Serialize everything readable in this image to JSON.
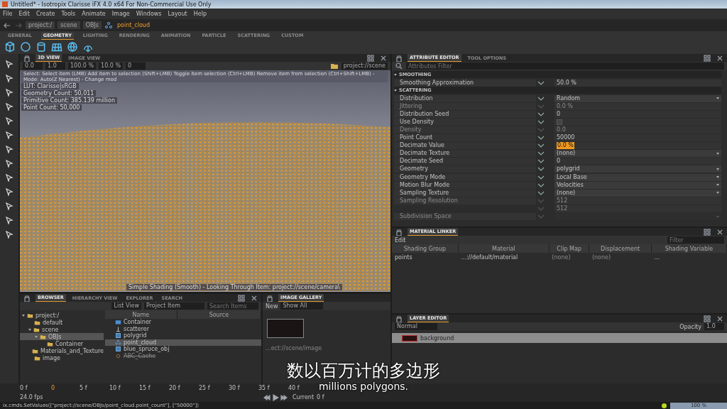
{
  "window": {
    "title": "Untitled* - Isotropix Clarisse iFX 4.0 x64  For Non-Commercial Use Only"
  },
  "menu": [
    "File",
    "Edit",
    "Create",
    "Tools",
    "Animate",
    "Image",
    "Windows",
    "Layout",
    "Help"
  ],
  "path_bar": {
    "segments": [
      "project:/",
      "scene",
      "OBJs"
    ],
    "current": "point_cloud"
  },
  "shelf": {
    "tabs": [
      {
        "label": "GENERAL",
        "selected": false
      },
      {
        "label": "GEOMETRY",
        "selected": true
      },
      {
        "label": "LIGHTING",
        "selected": false
      },
      {
        "label": "RENDERING",
        "selected": false
      },
      {
        "label": "ANIMATION",
        "selected": false
      },
      {
        "label": "PARTICLE",
        "selected": false
      },
      {
        "label": "SCATTERING",
        "selected": false
      },
      {
        "label": "CUSTOM",
        "selected": false
      }
    ]
  },
  "viewport": {
    "tabs": [
      {
        "label": "3D VIEW",
        "selected": true
      },
      {
        "label": "IMAGE VIEW",
        "selected": false
      }
    ],
    "toolbar_fields": [
      "0.0",
      "1.0",
      "100.0 %",
      "10.0 %",
      "0"
    ],
    "path": "project://scene",
    "hint": "Select: Select item (LMB)  Add item to selection (Shift+LMB)  Toggle item selection (Ctrl+LMB)  Remove item from selection (Ctrl+Shift+LMB)  - Mode: Auto(Z Nearest) - Change mod",
    "info": [
      "LUT: Clarisse|sRGB",
      "Geometry Count: 50,011",
      "Primitive Count: 385.139 million",
      "Point Count: 50,000"
    ],
    "status": "Simple Shading (Smooth) - Looking Through Item: project://scene/camera\\"
  },
  "attribute_editor": {
    "tabs": [
      {
        "label": "ATTRIBUTE EDITOR",
        "selected": true
      },
      {
        "label": "TOOL OPTIONS",
        "selected": false
      }
    ],
    "filter_placeholder": "Attributes Filter",
    "groups": [
      {
        "title": "SMOOTHING",
        "rows": [
          {
            "label": "Smoothing Approximation",
            "kind": "number",
            "value": "50.0 %",
            "disabled": false,
            "focused": false
          }
        ]
      },
      {
        "title": "SCATTERING",
        "rows": [
          {
            "label": "Distribution",
            "kind": "dropdown",
            "value": "Random",
            "disabled": false,
            "focused": false
          },
          {
            "label": "Jittering",
            "kind": "number",
            "value": "0.0 %",
            "disabled": true,
            "focused": false
          },
          {
            "label": "Distribution Seed",
            "kind": "number",
            "value": "0",
            "disabled": false,
            "focused": false
          },
          {
            "label": "Use Density",
            "kind": "checkbox",
            "checked": false,
            "disabled": false,
            "focused": false
          },
          {
            "label": "Density",
            "kind": "number",
            "value": "0.0",
            "disabled": true,
            "focused": false
          },
          {
            "label": "Point Count",
            "kind": "number",
            "value": "50000",
            "disabled": false,
            "focused": false
          },
          {
            "label": "Decimate Value",
            "kind": "number",
            "value": "0.0 %",
            "disabled": false,
            "focused": true
          },
          {
            "label": "Decimate Texture",
            "kind": "dropdown",
            "value": "(none)",
            "disabled": false,
            "focused": false
          },
          {
            "label": "Decimate Seed",
            "kind": "number",
            "value": "0",
            "disabled": false,
            "focused": false
          },
          {
            "label": "Geometry",
            "kind": "dropdown",
            "value": "polygrid",
            "disabled": false,
            "focused": false
          },
          {
            "label": "Geometry Mode",
            "kind": "dropdown",
            "value": "Local Base",
            "disabled": false,
            "focused": false
          },
          {
            "label": "Motion Blur Mode",
            "kind": "dropdown",
            "value": "Velocities",
            "disabled": false,
            "focused": false
          },
          {
            "label": "Sampling Texture",
            "kind": "dropdown",
            "value": "(none)",
            "disabled": false,
            "focused": false
          },
          {
            "label": "Sampling Resolution",
            "kind": "number",
            "value": "512",
            "disabled": true,
            "focused": false
          },
          {
            "kind": "number",
            "value": "512",
            "disabled": true,
            "focused": false
          },
          {
            "label": "Subdivision Space",
            "kind": "dropdown",
            "disabled": true,
            "focused": false
          }
        ]
      }
    ]
  },
  "material_linker": {
    "tab": "MATERIAL LINKER",
    "edit": "Edit",
    "filter_placeholder": "Filter",
    "columns": [
      "Shading Group",
      "Material",
      "Clip Map",
      "Displacement",
      "Shading Variable"
    ],
    "rows": [
      {
        "cells": [
          "points",
          "...://default/material",
          "(none)",
          "(none)",
          "..."
        ]
      }
    ]
  },
  "layer_editor": {
    "tab": "LAYER EDITOR",
    "blend": "Normal",
    "opacity_label": "Opacity",
    "opacity": "1.0",
    "layers": [
      {
        "name": "background",
        "selected": true
      }
    ]
  },
  "browser": {
    "tabs": [
      {
        "label": "BROWSER",
        "selected": true
      },
      {
        "label": "HIERARCHY VIEW",
        "selected": false
      },
      {
        "label": "EXPLORER",
        "selected": false
      },
      {
        "label": "SEARCH",
        "selected": false
      }
    ],
    "view": "List View",
    "filter": "Project Item",
    "search_placeholder": "Search Items",
    "tree": [
      {
        "label": "project:/",
        "expanded": true,
        "selected": false,
        "children": [
          {
            "label": "default",
            "selected": false
          },
          {
            "label": "scene",
            "expanded": true,
            "selected": false,
            "children": [
              {
                "label": "OBJs",
                "expanded": true,
                "selected": true,
                "children": [
                  {
                    "label": "Container",
                    "selected": false
                  }
                ]
              }
            ]
          },
          {
            "label": "Materials_and_Texture",
            "selected": false
          },
          {
            "label": "image",
            "selected": false
          }
        ]
      }
    ],
    "columns": [
      "Name",
      "Source"
    ],
    "items": [
      {
        "name": "Container",
        "kind": "container",
        "selected": false,
        "disabled": false
      },
      {
        "name": "scatterer",
        "kind": "scatterer",
        "selected": false,
        "disabled": false
      },
      {
        "name": "polygrid",
        "kind": "geometry",
        "selected": false,
        "disabled": false
      },
      {
        "name": "point_cloud",
        "kind": "points",
        "selected": true,
        "disabled": false
      },
      {
        "name": "blue_spruce_obj",
        "kind": "geometry",
        "selected": false,
        "disabled": false
      },
      {
        "name": "ABC_Cache",
        "kind": "cache",
        "selected": false,
        "disabled": true
      }
    ]
  },
  "image_gallery": {
    "tab": "IMAGE GALLERY",
    "new": "New",
    "filter": "Show All",
    "caption": "...ect://scene/image"
  },
  "timeline": {
    "start": "0 f",
    "cursor": "0",
    "ticks": [
      "5 f",
      "10 f",
      "15 f",
      "20 f",
      "25 f",
      "30 f",
      "35 f",
      "40 f"
    ],
    "fps": "24.0 fps",
    "current_label": "Current",
    "current": "0 f"
  },
  "status_bar": {
    "command": "ix.cmds.SetValues([\"project://scene/OBJs/point_cloud.point_count\"], [\"50000\"])",
    "zoom": "100 %"
  },
  "subtitle": [
    "数以百万计的多边形",
    "millions polygons."
  ]
}
